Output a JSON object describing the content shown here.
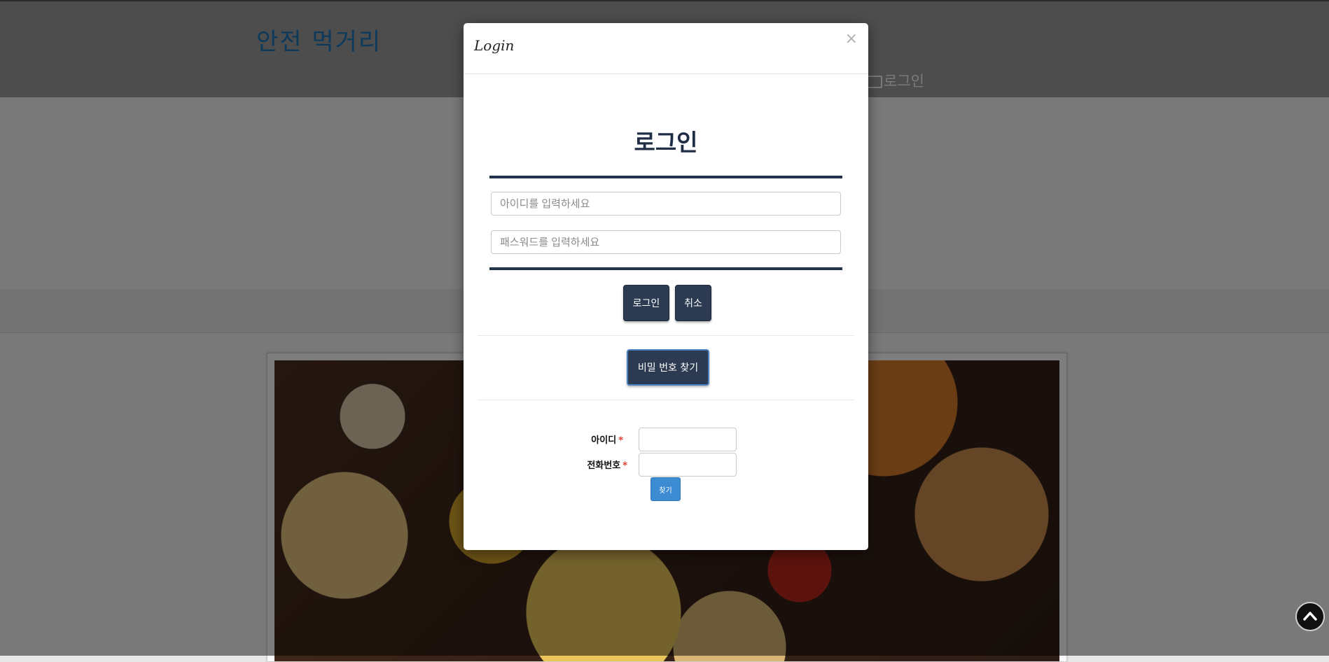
{
  "site": {
    "logo": "안전 먹거리",
    "header_login": "로그인"
  },
  "modal": {
    "title": "Login",
    "close": "×",
    "heading": "로그인",
    "id_input": {
      "placeholder": "아이디를 입력하세요",
      "value": ""
    },
    "password_input": {
      "placeholder": "패스워드를 입력하세요",
      "value": ""
    },
    "login_button": "로그인",
    "cancel_button": "취소",
    "find_password_button": "비밀 번호 찾기",
    "find_form": {
      "id_label": "아이디",
      "phone_label": "전화번호",
      "required_mark": "*",
      "submit_button": "찾기"
    }
  },
  "back_to_top_icon": "chevron-up-icon",
  "colors": {
    "navy": "#2c3b52",
    "find_blue": "#3d8bd3",
    "required_red": "#e3271b",
    "logo_blue": "#1a73b6"
  }
}
